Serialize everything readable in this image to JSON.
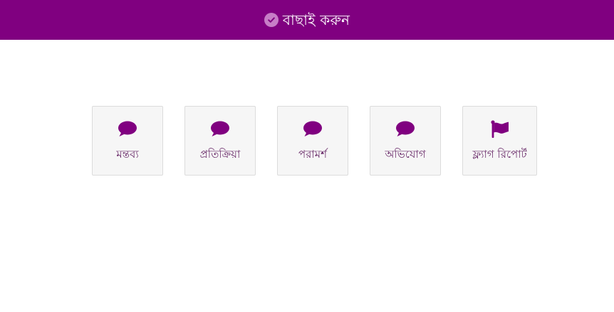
{
  "header": {
    "title": "বাছাই করুন",
    "icon": "check-circle-icon",
    "background": "#800080"
  },
  "accent_color": "#800080",
  "options": [
    {
      "label": "মন্তব্য",
      "icon": "speech-bubble-icon"
    },
    {
      "label": "প্রতিক্রিয়া",
      "icon": "speech-bubble-icon"
    },
    {
      "label": "পরামর্শ",
      "icon": "speech-bubble-icon"
    },
    {
      "label": "অভিযোগ",
      "icon": "speech-bubble-icon"
    },
    {
      "label": "ফ্ল্যাগ রিপোর্ট",
      "icon": "flag-icon"
    }
  ]
}
